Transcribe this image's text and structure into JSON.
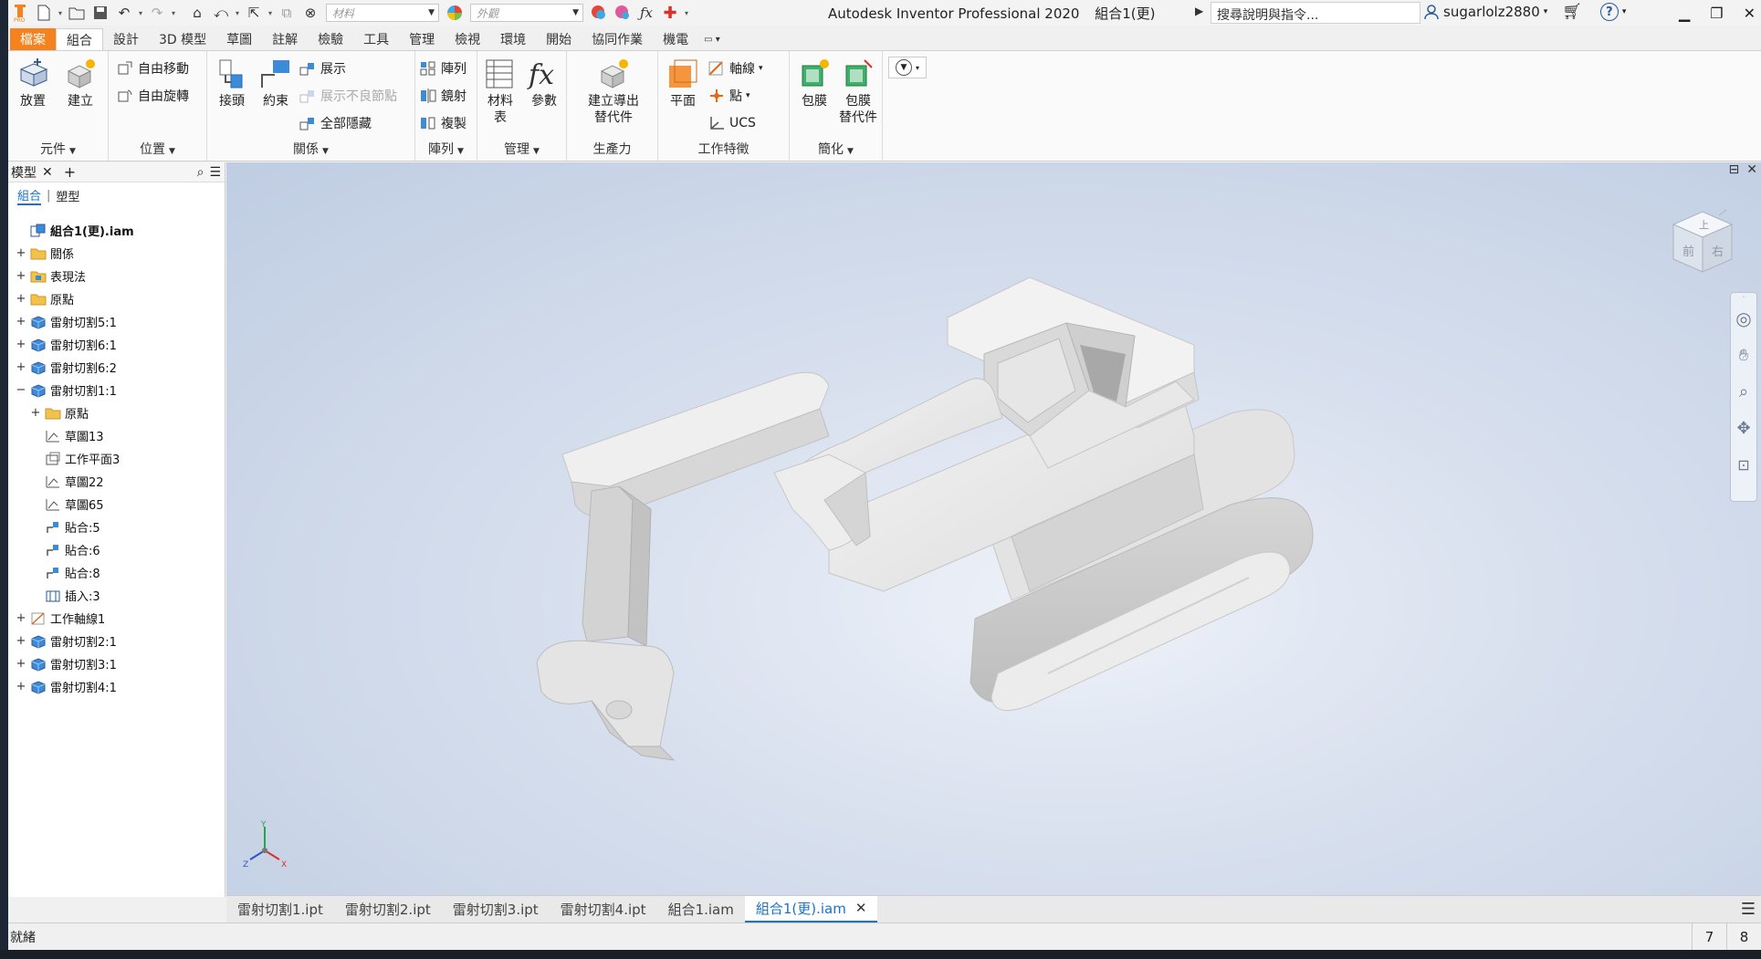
{
  "titlebar": {
    "app_title": "Autodesk Inventor Professional 2020",
    "doc_title": "組合1(更)",
    "material_placeholder": "材料",
    "appearance_placeholder": "外觀",
    "search_placeholder": "搜尋說明與指令...",
    "username": "sugarlolz2880"
  },
  "tabs": [
    {
      "label": "檔案"
    },
    {
      "label": "組合"
    },
    {
      "label": "設計"
    },
    {
      "label": "3D 模型"
    },
    {
      "label": "草圖"
    },
    {
      "label": "註解"
    },
    {
      "label": "檢驗"
    },
    {
      "label": "工具"
    },
    {
      "label": "管理"
    },
    {
      "label": "檢視"
    },
    {
      "label": "環境"
    },
    {
      "label": "開始"
    },
    {
      "label": "協同作業"
    },
    {
      "label": "機電"
    }
  ],
  "ribbon": {
    "component": {
      "title": "元件",
      "place": "放置",
      "create": "建立"
    },
    "position": {
      "title": "位置",
      "free_move": "自由移動",
      "free_rotate": "自由旋轉"
    },
    "relationships": {
      "title": "關係",
      "joint": "接頭",
      "constrain": "約束",
      "show": "展示",
      "show_sick": "展示不良節點",
      "hide_all": "全部隱藏"
    },
    "pattern": {
      "title": "陣列",
      "pattern": "陣列",
      "mirror": "鏡射",
      "copy": "複製"
    },
    "manage": {
      "title": "管理",
      "bom_line1": "材料",
      "bom_line2": "表",
      "parameters": "參數"
    },
    "productivity": {
      "title": "生產力",
      "derived_line1": "建立導出",
      "derived_line2": "替代件"
    },
    "work_features": {
      "title": "工作特徵",
      "plane": "平面",
      "axis": "軸線",
      "point": "點",
      "ucs": "UCS"
    },
    "simplification": {
      "title": "簡化",
      "shrinkwrap": "包膜",
      "shrinkwrap_sub_line1": "包膜",
      "shrinkwrap_sub_line2": "替代件"
    }
  },
  "browser": {
    "title": "模型",
    "view_assembly": "組合",
    "view_modeling": "塑型",
    "nodes": [
      {
        "label": "組合1(更).iam",
        "level": 0,
        "expander": "",
        "icon": "assembly-icon"
      },
      {
        "label": "關係",
        "level": 0,
        "expander": "+",
        "icon": "folder-icon"
      },
      {
        "label": "表現法",
        "level": 0,
        "expander": "+",
        "icon": "representations-icon"
      },
      {
        "label": "原點",
        "level": 0,
        "expander": "+",
        "icon": "folder-icon"
      },
      {
        "label": "雷射切割5:1",
        "level": 0,
        "expander": "+",
        "icon": "part-icon"
      },
      {
        "label": "雷射切割6:1",
        "level": 0,
        "expander": "+",
        "icon": "part-icon"
      },
      {
        "label": "雷射切割6:2",
        "level": 0,
        "expander": "+",
        "icon": "part-icon"
      },
      {
        "label": "雷射切割1:1",
        "level": 0,
        "expander": "−",
        "icon": "part-icon"
      },
      {
        "label": "原點",
        "level": 1,
        "expander": "+",
        "icon": "folder-icon"
      },
      {
        "label": "草圖13",
        "level": 1,
        "expander": "",
        "icon": "sketch-icon"
      },
      {
        "label": "工作平面3",
        "level": 1,
        "expander": "",
        "icon": "work-plane-icon"
      },
      {
        "label": "草圖22",
        "level": 1,
        "expander": "",
        "icon": "sketch-icon"
      },
      {
        "label": "草圖65",
        "level": 1,
        "expander": "",
        "icon": "sketch-icon"
      },
      {
        "label": "貼合:5",
        "level": 1,
        "expander": "",
        "icon": "mate-icon"
      },
      {
        "label": "貼合:6",
        "level": 1,
        "expander": "",
        "icon": "mate-icon"
      },
      {
        "label": "貼合:8",
        "level": 1,
        "expander": "",
        "icon": "mate-icon"
      },
      {
        "label": "插入:3",
        "level": 1,
        "expander": "",
        "icon": "insert-icon"
      },
      {
        "label": "工作軸線1",
        "level": 0,
        "expander": "+",
        "icon": "work-axis-icon"
      },
      {
        "label": "雷射切割2:1",
        "level": 0,
        "expander": "+",
        "icon": "part-icon"
      },
      {
        "label": "雷射切割3:1",
        "level": 0,
        "expander": "+",
        "icon": "part-icon"
      },
      {
        "label": "雷射切割4:1",
        "level": 0,
        "expander": "+",
        "icon": "part-icon"
      }
    ]
  },
  "viewcube": {
    "front": "前",
    "right": "右",
    "top": "上"
  },
  "triad": {
    "x": "X",
    "y": "Y",
    "z": "Z"
  },
  "doc_tabs": [
    {
      "label": "雷射切割1.ipt",
      "active": false
    },
    {
      "label": "雷射切割2.ipt",
      "active": false
    },
    {
      "label": "雷射切割3.ipt",
      "active": false
    },
    {
      "label": "雷射切割4.ipt",
      "active": false
    },
    {
      "label": "組合1.iam",
      "active": false
    },
    {
      "label": "組合1(更).iam",
      "active": true
    }
  ],
  "status": {
    "text": "就緒",
    "count1": "7",
    "count2": "8"
  },
  "colors": {
    "accent": "#1a73c7",
    "file_tab": "#f4821f"
  }
}
